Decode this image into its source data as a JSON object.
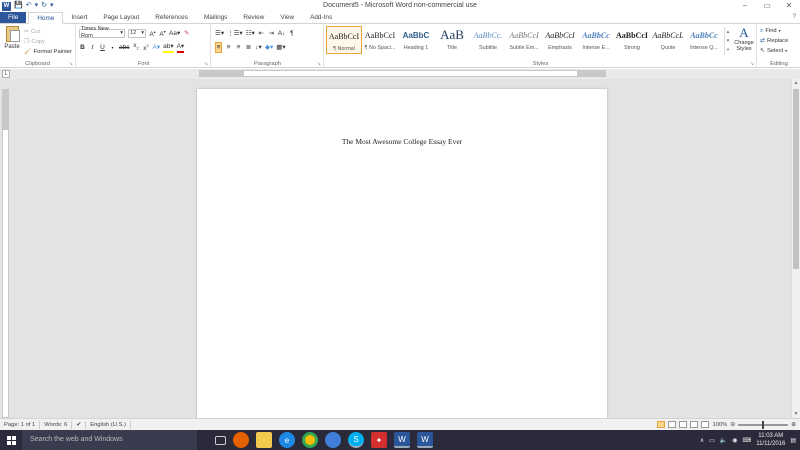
{
  "window": {
    "title": "Document5 - Microsoft Word non-commercial use",
    "help": "?",
    "minimize": "–",
    "restore": "▭",
    "close": "✕"
  },
  "tabs": [
    "File",
    "Home",
    "Insert",
    "Page Layout",
    "References",
    "Mailings",
    "Review",
    "View",
    "Add-Ins"
  ],
  "clipboard": {
    "paste": "Paste",
    "cut": "Cut",
    "copy": "Copy",
    "format_painter": "Format Painter",
    "label": "Clipboard"
  },
  "font": {
    "name": "Times New Rom",
    "size": "12",
    "label": "Font"
  },
  "paragraph": {
    "label": "Paragraph"
  },
  "styles": {
    "label": "Styles",
    "items": [
      {
        "preview": "AaBbCcI",
        "name": "¶ Normal"
      },
      {
        "preview": "AaBbCcI",
        "name": "¶ No Spaci..."
      },
      {
        "preview": "AaBbC",
        "name": "Heading 1"
      },
      {
        "preview": "AaB",
        "name": "Title"
      },
      {
        "preview": "AaBbCc.",
        "name": "Subtitle"
      },
      {
        "preview": "AaBbCcI",
        "name": "Subtle Em..."
      },
      {
        "preview": "AaBbCcI",
        "name": "Emphasis"
      },
      {
        "preview": "AaBbCc",
        "name": "Intense E..."
      },
      {
        "preview": "AaBbCcI",
        "name": "Strong"
      },
      {
        "preview": "AaBbCcL",
        "name": "Quote"
      },
      {
        "preview": "AaBbCc",
        "name": "Intense Q..."
      }
    ],
    "change_styles": "Change Styles"
  },
  "editing": {
    "label": "Editing",
    "find": "Find",
    "replace": "Replace",
    "select": "Select"
  },
  "document": {
    "title": "The Most Awesome College Essay Ever"
  },
  "status": {
    "page": "Page: 1 of 1",
    "words": "Words: 6",
    "language": "English (U.S.)",
    "zoom": "100%"
  },
  "taskbar": {
    "search": "Search the web and Windows",
    "time": "11:03 AM",
    "date": "11/11/2016"
  },
  "colors": {
    "word_blue": "#2b579a",
    "taskbar": "#2a2a3a",
    "highlight": "#fbd68c"
  }
}
